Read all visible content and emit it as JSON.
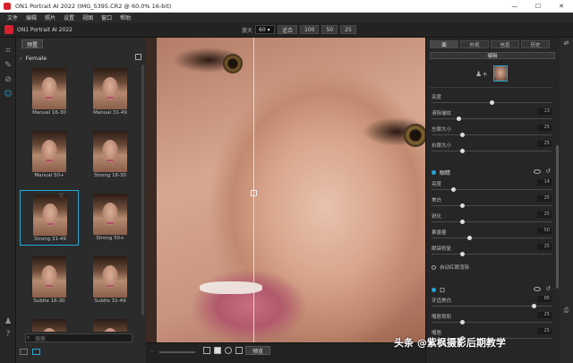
{
  "window": {
    "title": "ON1 Portrait AI 2022 (IMG_5395.CR2 @ 60.0% 16-bit)",
    "minimize": "—",
    "maximize": "☐",
    "close": "✕"
  },
  "menu": [
    "文件",
    "编辑",
    "照片",
    "设置",
    "视图",
    "窗口",
    "帮助"
  ],
  "app": {
    "name": "ON1 Portrait AI 2022",
    "zoom_label": "放大",
    "zoom_value": "60",
    "fit_label": "适合",
    "zoom_buttons": [
      "100",
      "50",
      "25"
    ]
  },
  "presets": {
    "tab_label": "预置",
    "category": "Female",
    "items": [
      {
        "caption": "Manual 16-30"
      },
      {
        "caption": "Manual 31-49"
      },
      {
        "caption": "Manual 50+"
      },
      {
        "caption": "Strong 16-30"
      },
      {
        "caption": "Strong 31-49"
      },
      {
        "caption": "Strong 50+"
      },
      {
        "caption": "Subtle 16-30"
      },
      {
        "caption": "Subtle 31-49"
      },
      {
        "caption": ""
      },
      {
        "caption": ""
      }
    ],
    "selected_index": 4,
    "search_placeholder": "搜索"
  },
  "canvas_bottom": {
    "preview_label": "预览"
  },
  "right_panel": {
    "tabs": [
      "面",
      "外观",
      "信息",
      "历史"
    ],
    "active_tab": 0,
    "subtab": "编辑",
    "face_adjustments": [
      {
        "label": "亮度",
        "value": "",
        "pos": 0.5
      },
      {
        "label": "清除皱纹",
        "value": "13",
        "pos": 0.22
      },
      {
        "label": "左眼大小",
        "value": "25",
        "pos": 0.25
      },
      {
        "label": "右眼大小",
        "value": "25",
        "pos": 0.25
      }
    ],
    "eyes_section": {
      "title": "眼睛"
    },
    "eyes_adjustments": [
      {
        "label": "亮度",
        "value": "14",
        "pos": 0.18
      },
      {
        "label": "美白",
        "value": "25",
        "pos": 0.25
      },
      {
        "label": "锐化",
        "value": "25",
        "pos": 0.25
      },
      {
        "label": "暴露量",
        "value": "50",
        "pos": 0.3
      },
      {
        "label": "眼袋修复",
        "value": "25",
        "pos": 0.25
      }
    ],
    "auto_check_label": "自动红眼消除",
    "mouth_section": {
      "title": "口"
    },
    "mouth_adjustments": [
      {
        "label": "牙齿美白",
        "value": "86",
        "pos": 0.82
      },
      {
        "label": "嘴唇饱和",
        "value": "25",
        "pos": 0.25
      },
      {
        "label": "嘴唇",
        "value": "25",
        "pos": 0.25
      }
    ]
  },
  "watermark": "头条 @紫枫摄影后期教学",
  "colors": {
    "accent": "#22a9d8",
    "brand": "#d6232f"
  }
}
